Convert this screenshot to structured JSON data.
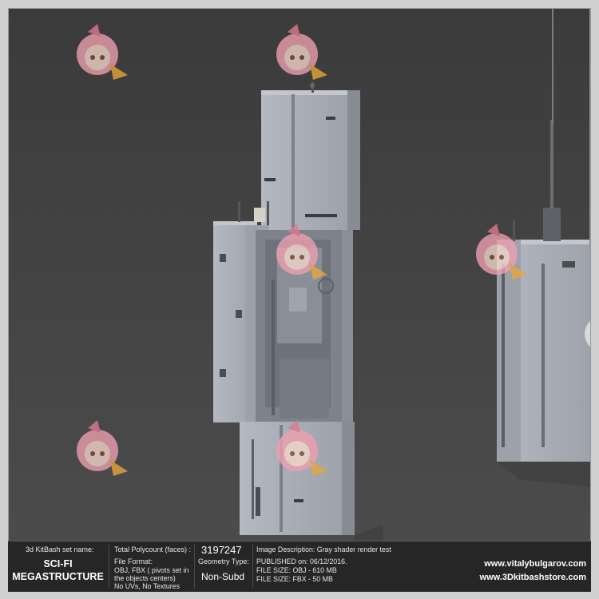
{
  "info": {
    "set_label": "3d KitBash set name:",
    "set_name_line1": "SCI-FI",
    "set_name_line2": "MEGASTRUCTURE",
    "polycount_label": "Total Polycount (faces) :",
    "polycount_value": "3197247",
    "file_format_label": "File Format:",
    "file_format_line1": "OBJ, FBX ( pivots set in",
    "file_format_line2": "the objects centers)",
    "file_format_line3": "No UVs, No Textures",
    "geometry_label": "Geometry Type:",
    "geometry_value": "Non-Subd",
    "description": "Image Description: Gray shader render test",
    "published": "PUBLISHED on: 06/12/2016.",
    "file_size_obj": "FILE SIZE: OBJ - 610 MB",
    "file_size_fbx": "FILE SIZE: FBX - 50 MB",
    "url1": "www.vitalybulgarov.com",
    "url2": "www.3Dkitbashstore.com"
  },
  "colors": {
    "background": "#424242",
    "structure": "#a9adb5",
    "info_bar": "#262626",
    "mascot_hair": "#f0a0b0"
  },
  "icons": [
    "mascot-watermark-icon"
  ]
}
